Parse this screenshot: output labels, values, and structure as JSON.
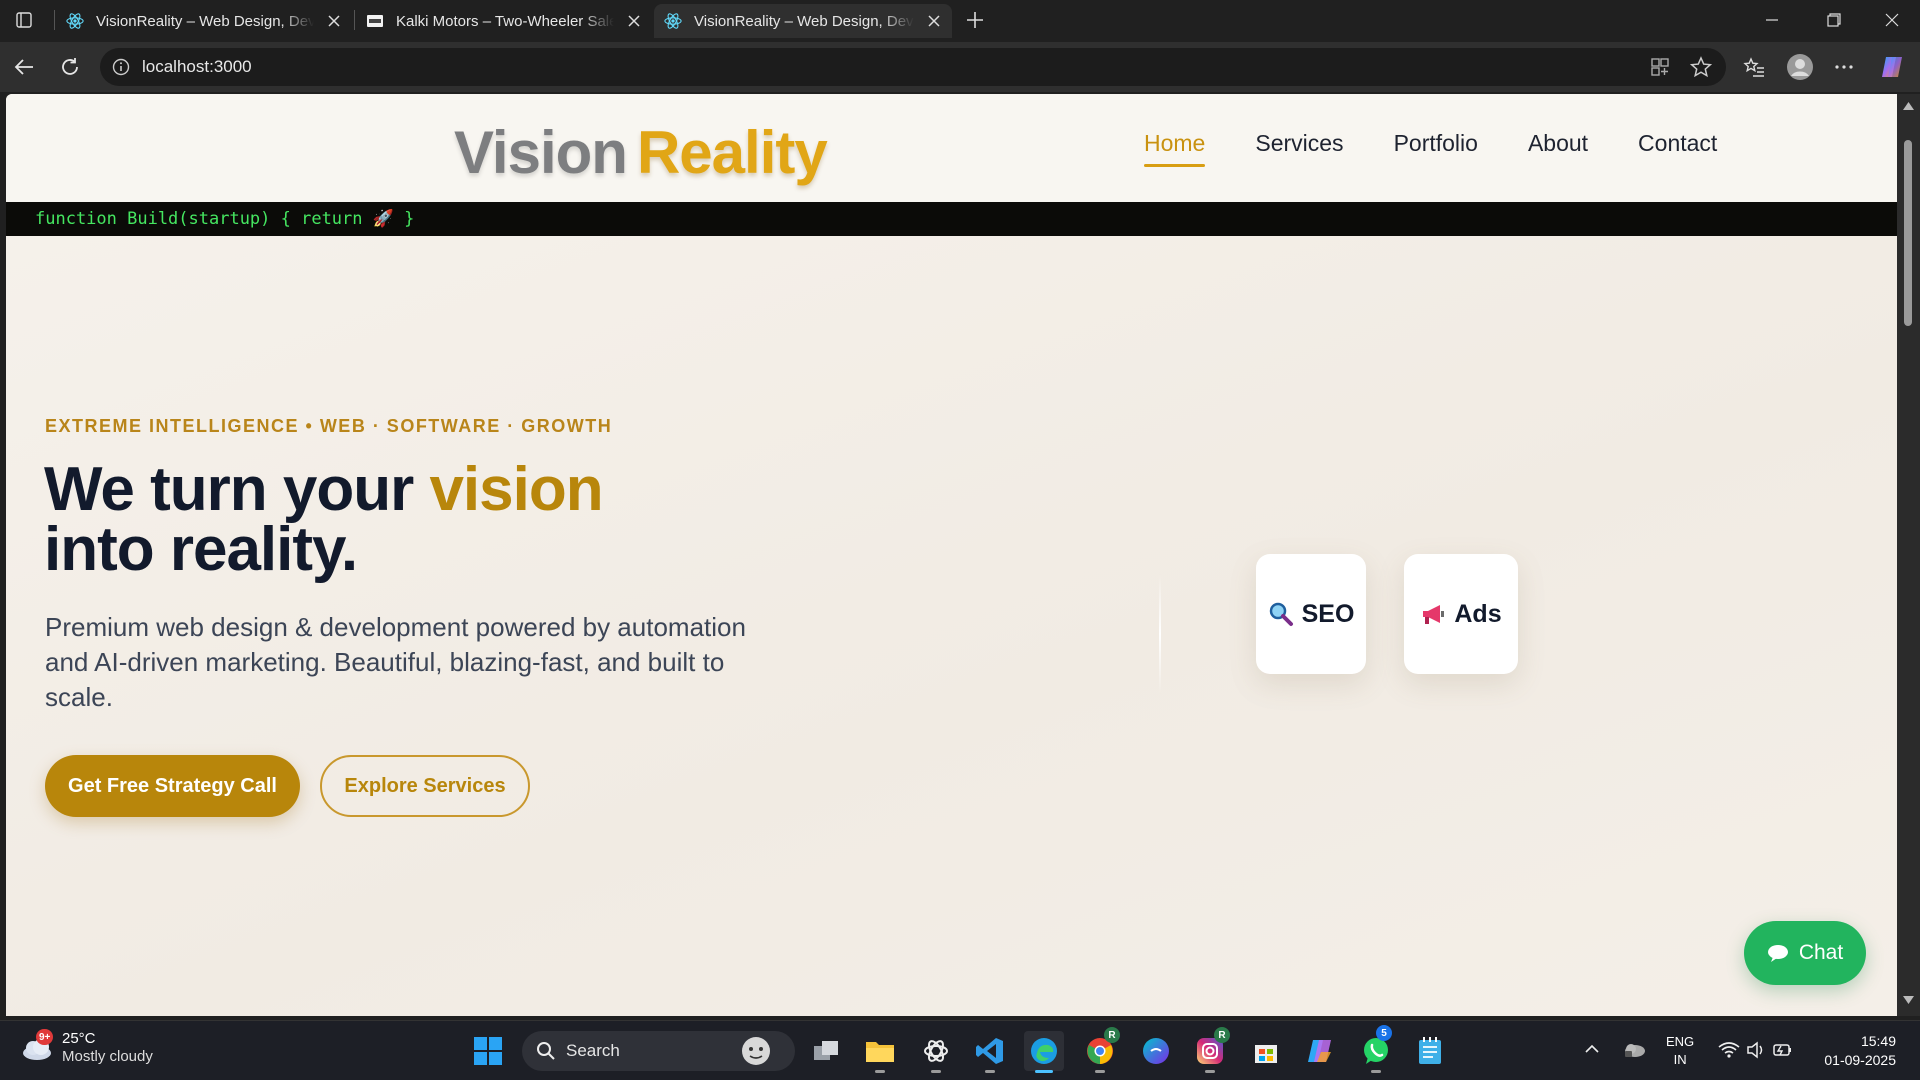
{
  "browser": {
    "tabs": [
      {
        "title": "VisionReality – Web Design, Development",
        "active": false
      },
      {
        "title": "Kalki Motors – Two-Wheeler Sales",
        "active": false
      },
      {
        "title": "VisionReality – Web Design, Development",
        "active": true
      }
    ],
    "url": "localhost:3000"
  },
  "site": {
    "logo": {
      "part1": "Vision",
      "part2": "Reality"
    },
    "nav": [
      "Home",
      "Services",
      "Portfolio",
      "About",
      "Contact"
    ],
    "active_nav": "Home",
    "codebar": "function Build(startup) { return 🚀 }",
    "hero": {
      "eyebrow": "EXTREME INTELLIGENCE • WEB · SOFTWARE · GROWTH",
      "headline_1": "We turn your ",
      "headline_highlight": "vision",
      "headline_2": "into reality.",
      "description": "Premium web design & development powered by automation and AI-driven marketing. Beautiful, blazing-fast, and built to scale.",
      "cta_primary": "Get Free Strategy Call",
      "cta_secondary": "Explore Services"
    },
    "chips": [
      {
        "icon": "magnifier-icon",
        "label": "SEO"
      },
      {
        "icon": "megaphone-icon",
        "label": "Ads"
      }
    ],
    "chat_label": "Chat"
  },
  "taskbar": {
    "weather_temp": "25°C",
    "weather_desc": "Mostly cloudy",
    "weather_badge": "9+",
    "search_label": "Search",
    "whatsapp_badge": "5",
    "lang_1": "ENG",
    "lang_2": "IN",
    "time": "15:49",
    "date": "01-09-2025"
  },
  "colors": {
    "brand_gold": "#b8860b",
    "logo_gray": "#7d7e80",
    "chat_green": "#22b45e",
    "headline_navy": "#121a2c"
  }
}
